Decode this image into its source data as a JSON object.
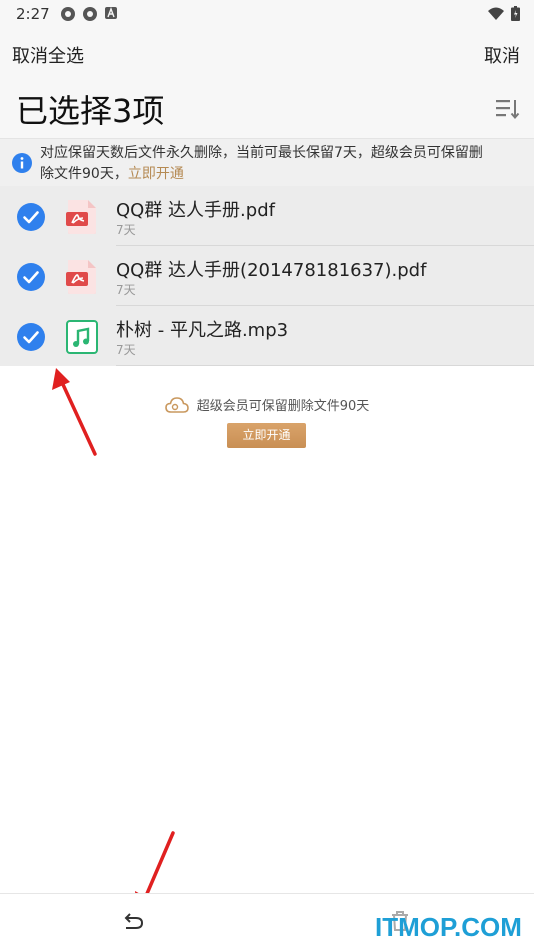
{
  "status": {
    "time": "2:27"
  },
  "header": {
    "cancel_select_all": "取消全选",
    "cancel": "取消",
    "title": "已选择3项"
  },
  "notice": {
    "text_line1": "对应保留天数后文件永久删除，当前可最长保留7天，超级会员可保留删",
    "text_line2": "除文件90天，",
    "link": "立即开通"
  },
  "files": [
    {
      "name": "QQ群 达人手册.pdf",
      "meta": "7天",
      "type": "pdf",
      "selected": true
    },
    {
      "name": "QQ群 达人手册(201478181637).pdf",
      "meta": "7天",
      "type": "pdf",
      "selected": true
    },
    {
      "name": "朴树 - 平凡之路.mp3",
      "meta": "7天",
      "type": "music",
      "selected": true
    }
  ],
  "vip": {
    "text": "超级会员可保留删除文件90天",
    "button": "立即开通"
  },
  "watermark": "ITMOP.COM",
  "colors": {
    "check_blue": "#2f80ed",
    "pdf_red": "#e04a4a",
    "music_green": "#2bb673",
    "gold": "#b58a53",
    "arrow_red": "#e02020"
  }
}
